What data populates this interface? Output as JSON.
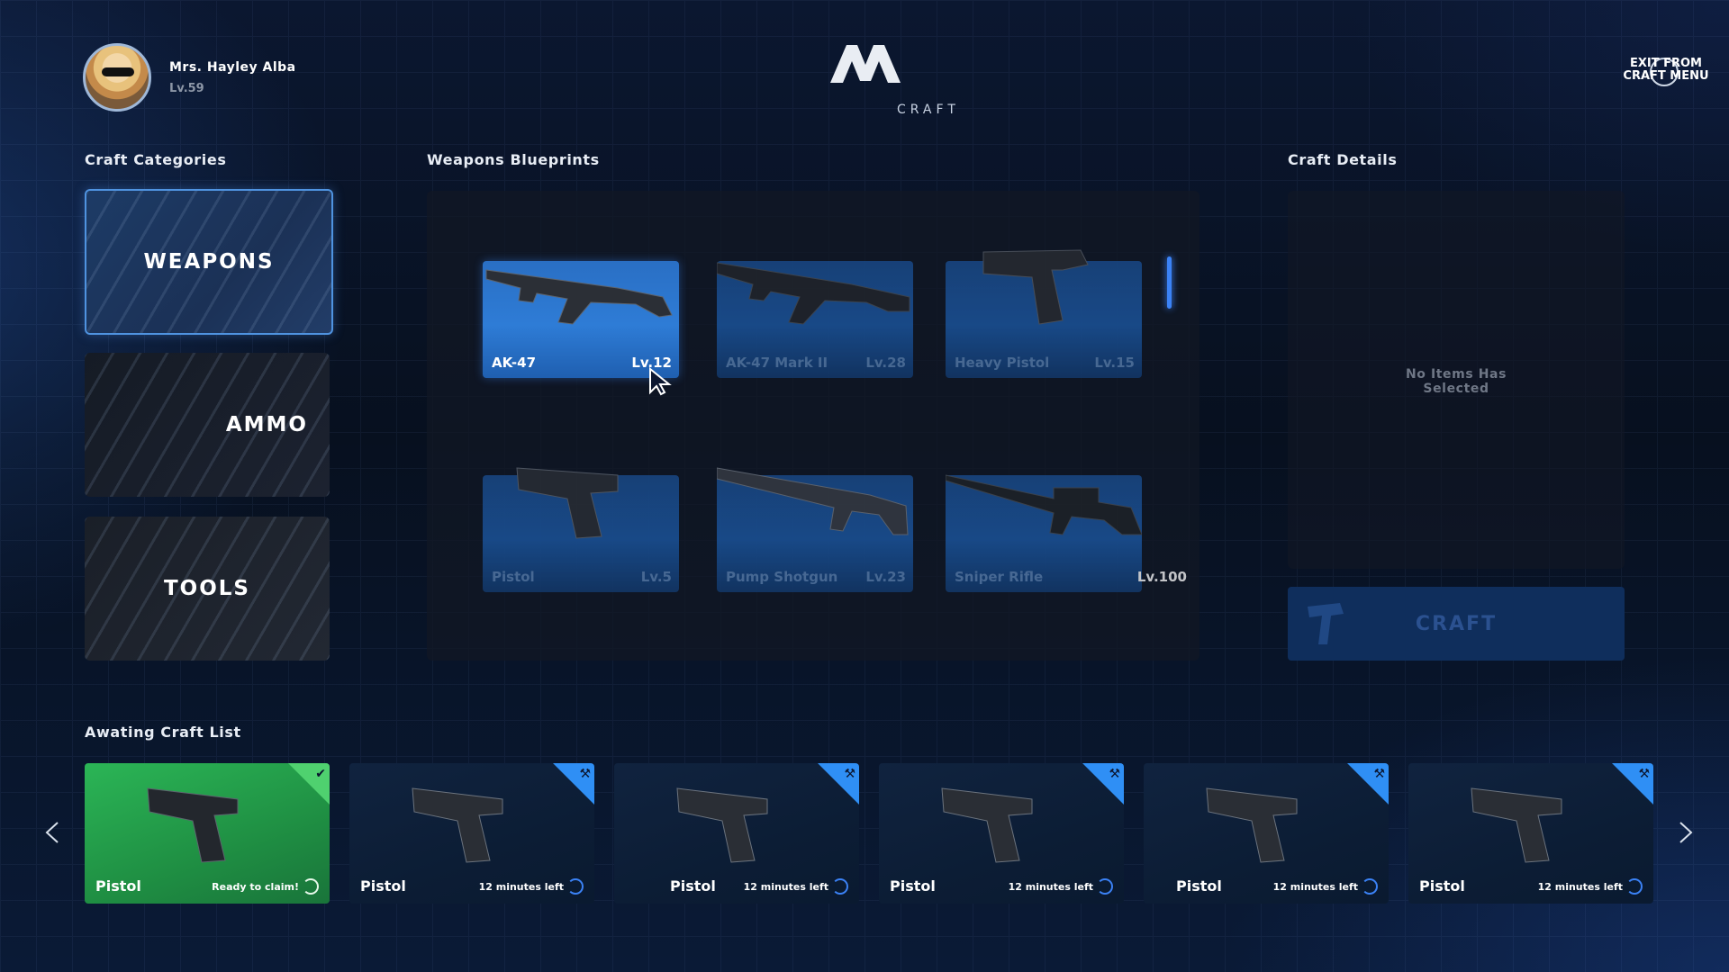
{
  "profile": {
    "name": "Mrs. Hayley Alba",
    "level": "Lv.59"
  },
  "header": {
    "logo_sub": "CRAFT",
    "exit_label_1": "EXIT FROM",
    "exit_label_2": "CRAFT MENU"
  },
  "sections": {
    "categories": "Craft Categories",
    "blueprints": "Weapons Blueprints",
    "details": "Craft Details",
    "queue": "Awating Craft List"
  },
  "categories": [
    {
      "label": "WEAPONS",
      "selected": true
    },
    {
      "label": "AMMO",
      "selected": false
    },
    {
      "label": "TOOLS",
      "selected": false
    }
  ],
  "blueprints": [
    {
      "name": "AK-47",
      "level": "Lv.12",
      "gun": "rifle-icon"
    },
    {
      "name": "AK-47 Mark II",
      "level": "Lv.28",
      "gun": "rifle-icon"
    },
    {
      "name": "Heavy Pistol",
      "level": "Lv.15",
      "gun": "pistol-icon"
    },
    {
      "name": "Pistol",
      "level": "Lv.5",
      "gun": "pistol-icon"
    },
    {
      "name": "Pump Shotgun",
      "level": "Lv.23",
      "gun": "shotgun-icon"
    },
    {
      "name": "Sniper Rifle",
      "level": "Lv.100",
      "gun": "sniper-icon"
    }
  ],
  "details": {
    "empty_line_1": "No Items Has",
    "empty_line_2": "Selected",
    "craft_label": "CRAFT"
  },
  "queue": [
    {
      "name": "Pistol",
      "status": "Ready to claim!",
      "ready": true
    },
    {
      "name": "Pistol",
      "status": "12 minutes left",
      "ready": false
    },
    {
      "name": "Pistol",
      "status": "12 minutes left",
      "ready": false
    },
    {
      "name": "Pistol",
      "status": "12 minutes left",
      "ready": false
    },
    {
      "name": "Pistol",
      "status": "12 minutes left",
      "ready": false
    },
    {
      "name": "Pistol",
      "status": "12 minutes left",
      "ready": false
    }
  ],
  "colors": {
    "accent": "#3b82f6",
    "ready": "#2bb556",
    "panel": "#121824"
  }
}
